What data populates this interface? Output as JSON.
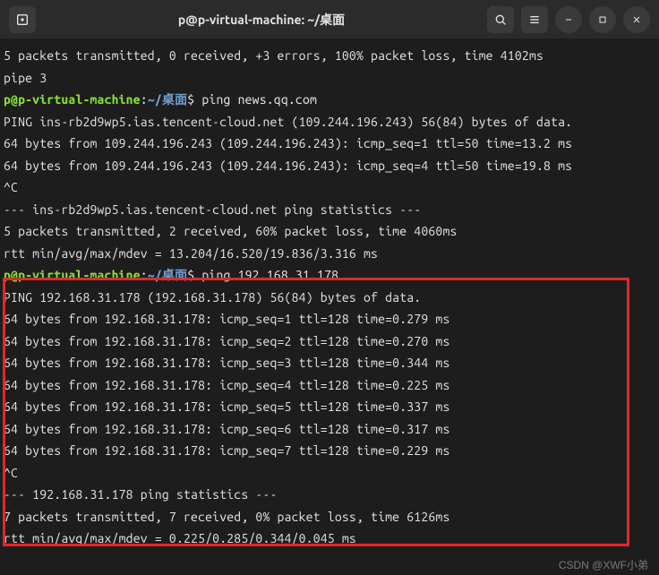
{
  "titlebar": {
    "title": "p@p-virtual-machine: ~/桌面"
  },
  "prompt": {
    "user_host": "p@p-virtual-machine",
    "sep": ":",
    "path": "~/桌面",
    "dollar": "$"
  },
  "lines": {
    "stats1": "5 packets transmitted, 0 received, +3 errors, 100% packet loss, time 4102ms",
    "pipe3": "pipe 3",
    "cmd1": " ping news.qq.com",
    "ping1_header": "PING ins-rb2d9wp5.ias.tencent-cloud.net (109.244.196.243) 56(84) bytes of data.",
    "ping1_r1": "64 bytes from 109.244.196.243 (109.244.196.243): icmp_seq=1 ttl=50 time=13.2 ms",
    "ping1_r2": "64 bytes from 109.244.196.243 (109.244.196.243): icmp_seq=4 ttl=50 time=19.8 ms",
    "ctrlc1": "^C",
    "ping1_stats_hdr": "--- ins-rb2d9wp5.ias.tencent-cloud.net ping statistics ---",
    "ping1_stats": "5 packets transmitted, 2 received, 60% packet loss, time 4060ms",
    "ping1_rtt": "rtt min/avg/max/mdev = 13.204/16.520/19.836/3.316 ms",
    "cmd2": " ping 192.168.31.178",
    "ping2_header": "PING 192.168.31.178 (192.168.31.178) 56(84) bytes of data.",
    "ping2_r1": "64 bytes from 192.168.31.178: icmp_seq=1 ttl=128 time=0.279 ms",
    "ping2_r2": "64 bytes from 192.168.31.178: icmp_seq=2 ttl=128 time=0.270 ms",
    "ping2_r3": "64 bytes from 192.168.31.178: icmp_seq=3 ttl=128 time=0.344 ms",
    "ping2_r4": "64 bytes from 192.168.31.178: icmp_seq=4 ttl=128 time=0.225 ms",
    "ping2_r5": "64 bytes from 192.168.31.178: icmp_seq=5 ttl=128 time=0.337 ms",
    "ping2_r6": "64 bytes from 192.168.31.178: icmp_seq=6 ttl=128 time=0.317 ms",
    "ping2_r7": "64 bytes from 192.168.31.178: icmp_seq=7 ttl=128 time=0.229 ms",
    "ctrlc2": "^C",
    "ping2_stats_hdr": "--- 192.168.31.178 ping statistics ---",
    "ping2_stats": "7 packets transmitted, 7 received, 0% packet loss, time 6126ms",
    "ping2_rtt": "rtt min/avg/max/mdev = 0.225/0.285/0.344/0.045 ms"
  },
  "watermark": "CSDN @XWF小弟"
}
